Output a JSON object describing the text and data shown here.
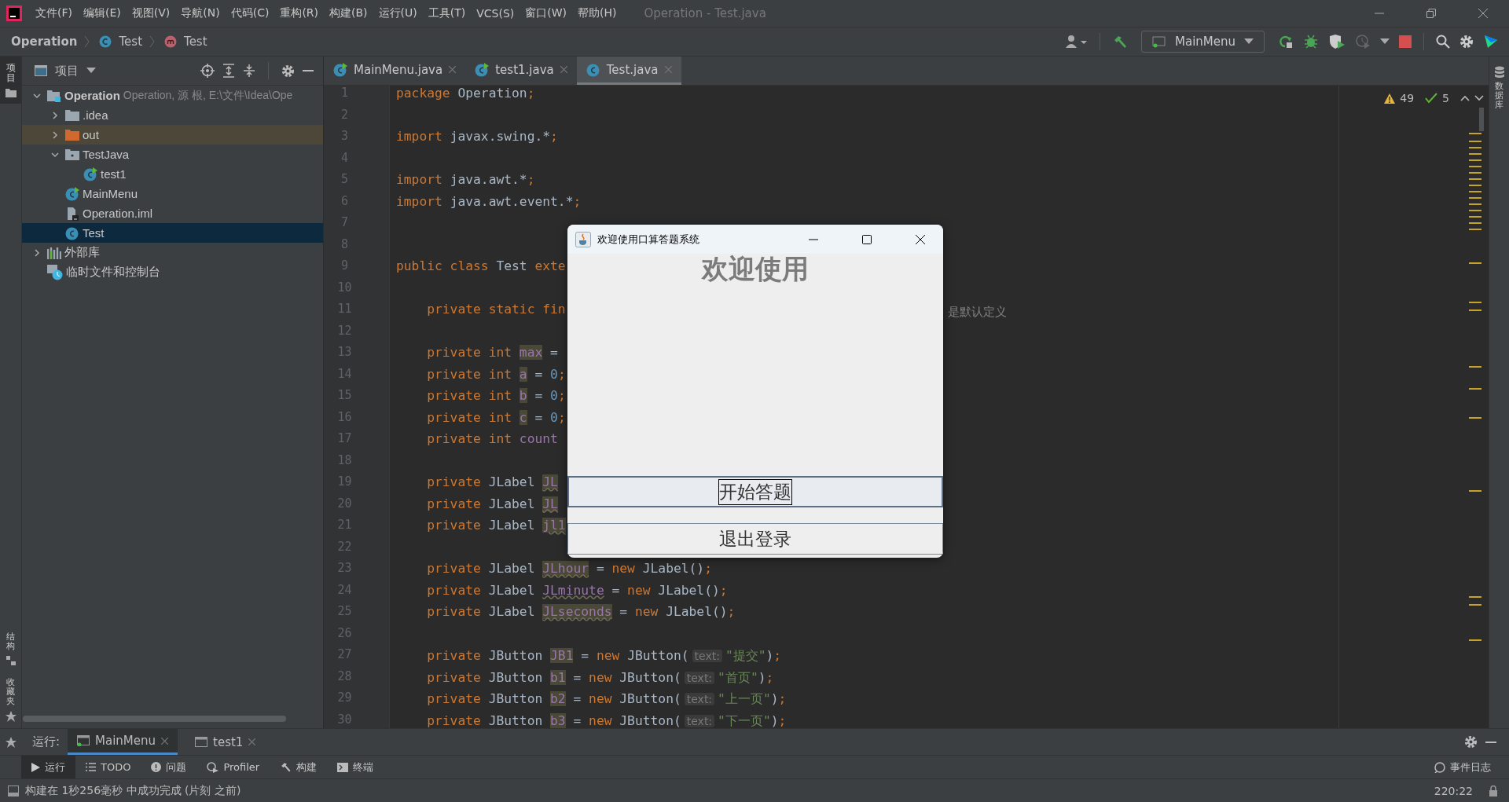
{
  "menu_bar": {
    "items": [
      "文件(F)",
      "编辑(E)",
      "视图(V)",
      "导航(N)",
      "代码(C)",
      "重构(R)",
      "构建(B)",
      "运行(U)",
      "工具(T)",
      "VCS(S)",
      "窗口(W)",
      "帮助(H)"
    ],
    "title": "Operation - Test.java"
  },
  "breadcrumbs": [
    {
      "label": "Operation",
      "kind": "project"
    },
    {
      "label": "Test",
      "kind": "class"
    },
    {
      "label": "Test",
      "kind": "method"
    }
  ],
  "run_config": {
    "label": "MainMenu"
  },
  "left_strip": {
    "top": "项目",
    "bottom": [
      "结构",
      "收藏夹"
    ]
  },
  "right_strip": {
    "label": "数据库"
  },
  "project_panel": {
    "title": "项目",
    "tree": [
      {
        "label": "Operation",
        "detail": "Operation, 源 根, E:\\文件\\Idea\\Ope",
        "kind": "module",
        "expanded": true,
        "selected": false,
        "children": [
          {
            "label": ".idea",
            "kind": "folder",
            "expanded": false,
            "selected": false
          },
          {
            "label": "out",
            "kind": "excluded_folder",
            "expanded": false,
            "selected": false
          },
          {
            "label": "TestJava",
            "kind": "source_folder",
            "expanded": true,
            "selected": false,
            "children": [
              {
                "label": "test1",
                "kind": "class_run",
                "selected": false
              }
            ]
          },
          {
            "label": "MainMenu",
            "kind": "class_run",
            "selected": false
          },
          {
            "label": "Operation.iml",
            "kind": "iml",
            "selected": false
          },
          {
            "label": "Test",
            "kind": "class",
            "selected": true
          }
        ]
      },
      {
        "label": "外部库",
        "kind": "library",
        "expanded": false,
        "selected": false
      },
      {
        "label": "临时文件和控制台",
        "kind": "scratch",
        "selected": false
      }
    ]
  },
  "editor_tabs": [
    {
      "label": "MainMenu.java",
      "kind": "class_run",
      "selected": false
    },
    {
      "label": "test1.java",
      "kind": "class_run",
      "selected": false
    },
    {
      "label": "Test.java",
      "kind": "class",
      "selected": true
    }
  ],
  "inspections": {
    "warnings": "49",
    "checks": "5"
  },
  "code_lines": [
    {
      "n": "1",
      "tokens": [
        {
          "kind": "kw",
          "text": "package"
        },
        {
          "kind": "id",
          "text": " Operation"
        },
        {
          "kind": "kw",
          "text": ";"
        }
      ]
    },
    {
      "n": "2"
    },
    {
      "n": "3",
      "tokens": [
        {
          "kind": "kw",
          "text": "import"
        },
        {
          "kind": "id",
          "text": " javax.swing.*"
        },
        {
          "kind": "kw",
          "text": ";"
        }
      ]
    },
    {
      "n": "4"
    },
    {
      "n": "5",
      "tokens": [
        {
          "kind": "kw",
          "text": "import"
        },
        {
          "kind": "id",
          "text": " java.awt.*"
        },
        {
          "kind": "kw",
          "text": ";"
        }
      ]
    },
    {
      "n": "6",
      "tokens": [
        {
          "kind": "kw",
          "text": "import"
        },
        {
          "kind": "id",
          "text": " java.awt.event.*"
        },
        {
          "kind": "kw",
          "text": ";"
        }
      ]
    },
    {
      "n": "7"
    },
    {
      "n": "8"
    },
    {
      "n": "9",
      "tokens": [
        {
          "kind": "kw",
          "text": "public class "
        },
        {
          "kind": "id",
          "text": "Test "
        },
        {
          "kind": "kw",
          "text": "exte"
        }
      ]
    },
    {
      "n": "10"
    },
    {
      "n": "11",
      "tokens": [
        {
          "kind": "kw",
          "text": "    private static fin"
        }
      ],
      "tail": "是默认定义"
    },
    {
      "n": "12"
    },
    {
      "n": "13",
      "tokens": [
        {
          "kind": "kw",
          "text": "    private int "
        },
        {
          "kind": "field_hl",
          "text": "max"
        },
        {
          "kind": "id",
          "text": " ="
        }
      ]
    },
    {
      "n": "14",
      "tokens": [
        {
          "kind": "kw",
          "text": "    private int "
        },
        {
          "kind": "field_hl",
          "text": "a"
        },
        {
          "kind": "id",
          "text": " = "
        },
        {
          "kind": "num",
          "text": "0"
        },
        {
          "kind": "kw",
          "text": ";"
        }
      ]
    },
    {
      "n": "15",
      "tokens": [
        {
          "kind": "kw",
          "text": "    private int "
        },
        {
          "kind": "field_hl",
          "text": "b"
        },
        {
          "kind": "id",
          "text": " = "
        },
        {
          "kind": "num",
          "text": "0"
        },
        {
          "kind": "kw",
          "text": ";"
        }
      ]
    },
    {
      "n": "16",
      "tokens": [
        {
          "kind": "kw",
          "text": "    private int "
        },
        {
          "kind": "field_hl",
          "text": "c"
        },
        {
          "kind": "id",
          "text": " = "
        },
        {
          "kind": "num",
          "text": "0"
        },
        {
          "kind": "kw",
          "text": ";"
        }
      ]
    },
    {
      "n": "17",
      "tokens": [
        {
          "kind": "kw",
          "text": "    private int "
        },
        {
          "kind": "field",
          "text": "count"
        }
      ]
    },
    {
      "n": "18"
    },
    {
      "n": "19",
      "tokens": [
        {
          "kind": "kw",
          "text": "    private "
        },
        {
          "kind": "id",
          "text": "JLabel "
        },
        {
          "kind": "field_warn",
          "text": "JL"
        }
      ]
    },
    {
      "n": "20",
      "tokens": [
        {
          "kind": "kw",
          "text": "    private "
        },
        {
          "kind": "id",
          "text": "JLabel "
        },
        {
          "kind": "field_warn",
          "text": "JL"
        }
      ]
    },
    {
      "n": "21",
      "tokens": [
        {
          "kind": "kw",
          "text": "    private "
        },
        {
          "kind": "id",
          "text": "JLabel "
        },
        {
          "kind": "field_warn",
          "text": "jl1"
        }
      ]
    },
    {
      "n": "22"
    },
    {
      "n": "23",
      "tokens": [
        {
          "kind": "kw",
          "text": "    private "
        },
        {
          "kind": "id",
          "text": "JLabel "
        },
        {
          "kind": "field_warn",
          "text": "JLhour"
        },
        {
          "kind": "id",
          "text": " = "
        },
        {
          "kind": "kw",
          "text": "new "
        },
        {
          "kind": "id",
          "text": "JLabel()"
        },
        {
          "kind": "kw",
          "text": ";"
        }
      ]
    },
    {
      "n": "24",
      "tokens": [
        {
          "kind": "kw",
          "text": "    private "
        },
        {
          "kind": "id",
          "text": "JLabel "
        },
        {
          "kind": "field_wave",
          "text": "JLminute"
        },
        {
          "kind": "id",
          "text": " = "
        },
        {
          "kind": "kw",
          "text": "new "
        },
        {
          "kind": "id",
          "text": "JLabel()"
        },
        {
          "kind": "kw",
          "text": ";"
        }
      ]
    },
    {
      "n": "25",
      "tokens": [
        {
          "kind": "kw",
          "text": "    private "
        },
        {
          "kind": "id",
          "text": "JLabel "
        },
        {
          "kind": "field_warn",
          "text": "JLseconds"
        },
        {
          "kind": "id",
          "text": " = "
        },
        {
          "kind": "kw",
          "text": "new "
        },
        {
          "kind": "id",
          "text": "JLabel()"
        },
        {
          "kind": "kw",
          "text": ";"
        }
      ]
    },
    {
      "n": "26"
    },
    {
      "n": "27",
      "tokens": [
        {
          "kind": "kw",
          "text": "    private "
        },
        {
          "kind": "id",
          "text": "JButton "
        },
        {
          "kind": "field_hl",
          "text": "JB1"
        },
        {
          "kind": "id",
          "text": " = "
        },
        {
          "kind": "kw",
          "text": "new "
        },
        {
          "kind": "id",
          "text": "JButton("
        },
        {
          "kind": "hint",
          "text": "text:"
        },
        {
          "kind": "str",
          "text": "\"提交\""
        },
        {
          "kind": "id",
          "text": ")"
        },
        {
          "kind": "kw",
          "text": ";"
        }
      ]
    },
    {
      "n": "28",
      "tokens": [
        {
          "kind": "kw",
          "text": "    private "
        },
        {
          "kind": "id",
          "text": "JButton "
        },
        {
          "kind": "field_hl",
          "text": "b1"
        },
        {
          "kind": "id",
          "text": " = "
        },
        {
          "kind": "kw",
          "text": "new "
        },
        {
          "kind": "id",
          "text": "JButton("
        },
        {
          "kind": "hint",
          "text": "text:"
        },
        {
          "kind": "str",
          "text": "\"首页\""
        },
        {
          "kind": "id",
          "text": ")"
        },
        {
          "kind": "kw",
          "text": ";"
        }
      ]
    },
    {
      "n": "29",
      "tokens": [
        {
          "kind": "kw",
          "text": "    private "
        },
        {
          "kind": "id",
          "text": "JButton "
        },
        {
          "kind": "field_hl",
          "text": "b2"
        },
        {
          "kind": "id",
          "text": " = "
        },
        {
          "kind": "kw",
          "text": "new "
        },
        {
          "kind": "id",
          "text": "JButton("
        },
        {
          "kind": "hint",
          "text": "text:"
        },
        {
          "kind": "str",
          "text": "\"上一页\""
        },
        {
          "kind": "id",
          "text": ")"
        },
        {
          "kind": "kw",
          "text": ";"
        }
      ]
    },
    {
      "n": "30",
      "tokens": [
        {
          "kind": "kw",
          "text": "    private "
        },
        {
          "kind": "id",
          "text": "JButton "
        },
        {
          "kind": "field_hl",
          "text": "b3"
        },
        {
          "kind": "id",
          "text": " = "
        },
        {
          "kind": "kw",
          "text": "new "
        },
        {
          "kind": "id",
          "text": "JButton("
        },
        {
          "kind": "hint",
          "text": "text:"
        },
        {
          "kind": "str",
          "text": "\"下一页\""
        },
        {
          "kind": "id",
          "text": ")"
        },
        {
          "kind": "kw",
          "text": ";"
        }
      ]
    }
  ],
  "dialog": {
    "title": "欢迎使用口算答题系统",
    "heading": "欢迎使用",
    "buttons": [
      {
        "label": "开始答题",
        "focused": true
      },
      {
        "label": "退出登录",
        "focused": false
      }
    ]
  },
  "run_bar": {
    "label": "运行:",
    "tabs": [
      {
        "label": "MainMenu",
        "selected": true
      },
      {
        "label": "test1",
        "selected": false
      }
    ]
  },
  "tool_windows": [
    {
      "label": "运行",
      "kind": "run",
      "selected": true
    },
    {
      "label": "TODO",
      "kind": "todo",
      "selected": false
    },
    {
      "label": "问题",
      "kind": "problems",
      "selected": false
    },
    {
      "label": "Profiler",
      "kind": "profiler",
      "selected": false
    },
    {
      "label": "构建",
      "kind": "build",
      "selected": false
    },
    {
      "label": "终端",
      "kind": "terminal",
      "selected": false
    }
  ],
  "event_log": "事件日志",
  "status_bar": {
    "message": "构建在 1秒256毫秒 中成功完成 (片刻 之前)",
    "position": "220:22"
  }
}
